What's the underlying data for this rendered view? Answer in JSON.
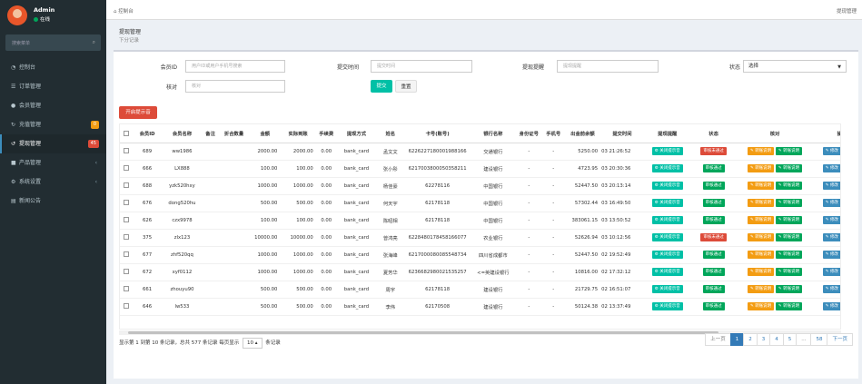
{
  "sidebar": {
    "user_name": "Admin",
    "user_status": "在线",
    "search_placeholder": "搜索菜单",
    "items": [
      {
        "label": "控制台",
        "icon": "dashboard-icon"
      },
      {
        "label": "订单管理",
        "icon": "list-icon"
      },
      {
        "label": "会员管理",
        "icon": "users-icon"
      },
      {
        "label": "充值管理",
        "icon": "recharge-icon",
        "badge": "0"
      },
      {
        "label": "提现管理",
        "icon": "withdraw-icon",
        "badge": "45"
      },
      {
        "label": "产品管理",
        "icon": "product-icon"
      },
      {
        "label": "系统设置",
        "icon": "settings-icon"
      },
      {
        "label": "新闻公告",
        "icon": "news-icon"
      }
    ]
  },
  "topbar": {
    "breadcrumb": "控制台",
    "right": "提现管理"
  },
  "page": {
    "title": "提现管理",
    "subtitle": "下分记录"
  },
  "filters": {
    "member_id_label": "会员ID",
    "member_id_placeholder": "用户ID或用户手机号搜索",
    "submit_time_label": "提交时间",
    "submit_time_placeholder": "提交时间",
    "remind_label": "提现提醒",
    "remind_placeholder": "提现提醒",
    "status_label": "状态",
    "status_value": "选择",
    "verify_label": "核对",
    "verify_placeholder": "核对",
    "submit_btn": "提交",
    "reset_btn": "重置"
  },
  "toolbar": {
    "open_remind_btn": "开启提示音"
  },
  "table": {
    "headers": [
      "会员ID",
      "会员名称",
      "备注",
      "折合数量",
      "金额",
      "实际到账",
      "手续费",
      "提现方式",
      "姓名",
      "卡号(账号)",
      "银行名称",
      "身份证号",
      "手机号",
      "出金前余额",
      "提交时间",
      "提现提醒",
      "状态",
      "核对",
      "操作"
    ],
    "rows": [
      {
        "id": "689",
        "name": "ww1986",
        "note": "",
        "qty": "",
        "amount": "2000.00",
        "actual": "2000.00",
        "fee": "0.00",
        "method": "bank_card",
        "real": "孟文文",
        "card": "6226227180001988166",
        "bank": "交通银行",
        "idno": "-",
        "phone": "-",
        "balance": "5250.00",
        "time": "03 21:26:52",
        "status": "审核未通过",
        "status_color": "rd"
      },
      {
        "id": "666",
        "name": "LX888",
        "note": "",
        "qty": "",
        "amount": "100.00",
        "actual": "100.00",
        "fee": "0.00",
        "method": "bank_card",
        "real": "张小彤",
        "card": "6217003800050358211",
        "bank": "建设银行",
        "idno": "-",
        "phone": "-",
        "balance": "4723.95",
        "time": "03 20:30:36",
        "status": "审核通过",
        "status_color": "g"
      },
      {
        "id": "688",
        "name": "yzk520hxy",
        "note": "",
        "qty": "",
        "amount": "1000.00",
        "actual": "1000.00",
        "fee": "0.00",
        "method": "bank_card",
        "real": "杨佳豪",
        "card": "62278116",
        "bank": "中国银行",
        "idno": "-",
        "phone": "-",
        "balance": "52447.50",
        "time": "03 20:13:14",
        "status": "审核通过",
        "status_color": "g"
      },
      {
        "id": "676",
        "name": "dong520hu",
        "note": "",
        "qty": "",
        "amount": "500.00",
        "actual": "500.00",
        "fee": "0.00",
        "method": "bank_card",
        "real": "何天宇",
        "card": "62178118",
        "bank": "中国银行",
        "idno": "-",
        "phone": "-",
        "balance": "57302.44",
        "time": "03 16:49:50",
        "status": "审核通过",
        "status_color": "g"
      },
      {
        "id": "626",
        "name": "czx9978",
        "note": "",
        "qty": "",
        "amount": "100.00",
        "actual": "100.00",
        "fee": "0.00",
        "method": "bank_card",
        "real": "陈昭相",
        "card": "62178118",
        "bank": "中国银行",
        "idno": "-",
        "phone": "-",
        "balance": "383061.15",
        "time": "03 13:50:52",
        "status": "审核通过",
        "status_color": "g"
      },
      {
        "id": "375",
        "name": "zlx123",
        "note": "",
        "qty": "",
        "amount": "10000.00",
        "actual": "10000.00",
        "fee": "0.00",
        "method": "bank_card",
        "real": "曾鸿亮",
        "card": "6228480178458166077",
        "bank": "农业银行",
        "idno": "-",
        "phone": "-",
        "balance": "52626.94",
        "time": "03 10:12:56",
        "status": "审核未通过",
        "status_color": "rd"
      },
      {
        "id": "677",
        "name": "zhf520qq",
        "note": "",
        "qty": "",
        "amount": "1000.00",
        "actual": "1000.00",
        "fee": "0.00",
        "method": "bank_card",
        "real": "张海峰",
        "card": "6217000080085548734",
        "bank": "四川省成都市",
        "idno": "-",
        "phone": "-",
        "balance": "52447.50",
        "time": "02 19:52:49",
        "status": "审核通过",
        "status_color": "g"
      },
      {
        "id": "672",
        "name": "xyf0112",
        "note": "",
        "qty": "",
        "amount": "1000.00",
        "actual": "1000.00",
        "fee": "0.00",
        "method": "bank_card",
        "real": "夏芳华",
        "card": "6236682980021535257",
        "bank": "<=英建设银行",
        "idno": "-",
        "phone": "-",
        "balance": "10816.00",
        "time": "02 17:32:12",
        "status": "审核通过",
        "status_color": "g"
      },
      {
        "id": "661",
        "name": "zhouyu90",
        "note": "",
        "qty": "",
        "amount": "500.00",
        "actual": "500.00",
        "fee": "0.00",
        "method": "bank_card",
        "real": "周宇",
        "card": "62178118",
        "bank": "建设银行",
        "idno": "-",
        "phone": "-",
        "balance": "21729.75",
        "time": "02 16:51:07",
        "status": "审核通过",
        "status_color": "g"
      },
      {
        "id": "646",
        "name": "lw533",
        "note": "",
        "qty": "",
        "amount": "500.00",
        "actual": "500.00",
        "fee": "0.00",
        "method": "bank_card",
        "real": "李伟",
        "card": "62170508",
        "bank": "建设银行",
        "idno": "-",
        "phone": "-",
        "balance": "50124.38",
        "time": "02 13:37:49",
        "status": "审核通过",
        "status_color": "g"
      }
    ],
    "remind_btn": "关闭提示音",
    "verify_btns": [
      "转账说明",
      "转账说明"
    ],
    "action_btns": [
      "修改",
      "编辑"
    ]
  },
  "pagination": {
    "info_prefix": "显示第 1 到第 10 条记录，总共 577 条记录 每页显示",
    "page_size": "10",
    "info_suffix": "条记录",
    "prev": "上一页",
    "pages": [
      "1",
      "2",
      "3",
      "4",
      "5",
      "...",
      "58"
    ],
    "next": "下一页"
  },
  "colors": {
    "sidebar_bg": "#222d32",
    "green": "#00a65a",
    "red": "#dd4b39",
    "orange": "#f39c12",
    "blue": "#3c8dbc",
    "teal": "#00c0a6"
  }
}
